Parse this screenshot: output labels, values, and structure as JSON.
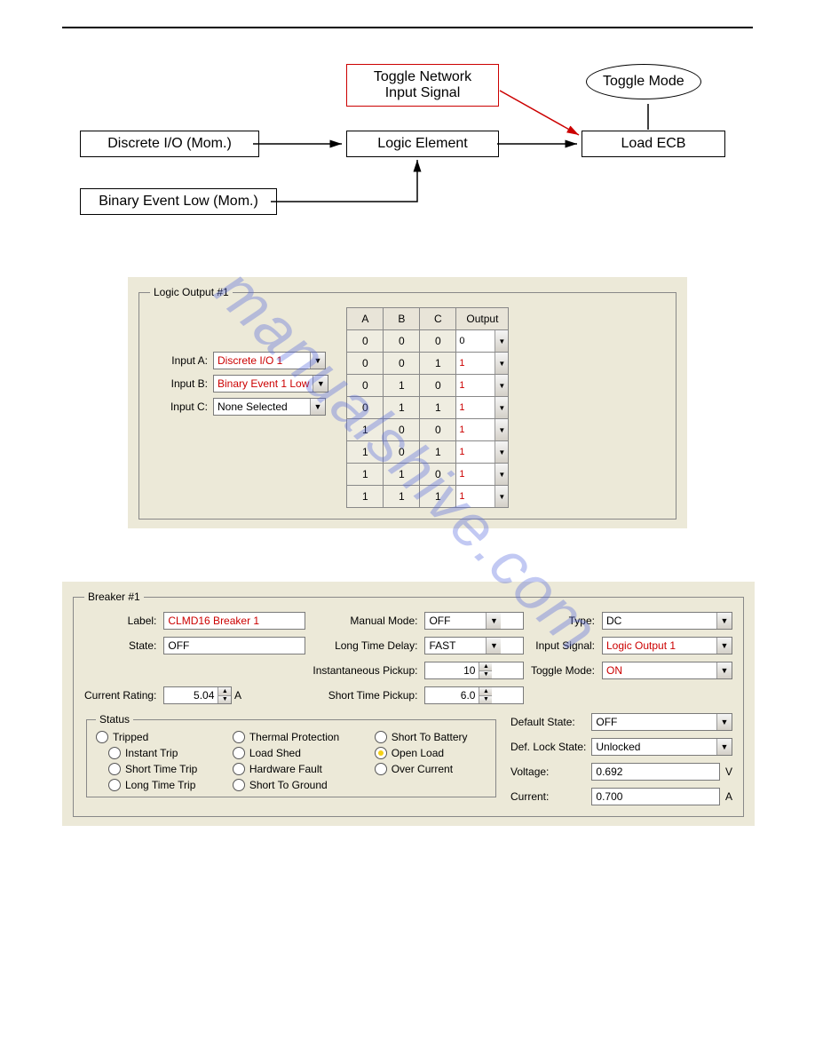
{
  "watermark": "manualshive.com",
  "diagram": {
    "discrete_io": "Discrete I/O (Mom.)",
    "binary_event": "Binary Event Low (Mom.)",
    "logic_element": "Logic Element",
    "toggle_network": "Toggle Network Input Signal",
    "load_ecb": "Load ECB",
    "toggle_mode": "Toggle Mode"
  },
  "logic": {
    "title": "Logic Output #1",
    "input_a_label": "Input A:",
    "input_b_label": "Input B:",
    "input_c_label": "Input C:",
    "input_a_value": "Discrete I/O 1",
    "input_b_value": "Binary Event 1 Low",
    "input_c_value": "None Selected",
    "headers": {
      "a": "A",
      "b": "B",
      "c": "C",
      "out": "Output"
    },
    "rows": [
      {
        "a": "0",
        "b": "0",
        "c": "0",
        "out": "0",
        "out_red": false
      },
      {
        "a": "0",
        "b": "0",
        "c": "1",
        "out": "1",
        "out_red": true
      },
      {
        "a": "0",
        "b": "1",
        "c": "0",
        "out": "1",
        "out_red": true
      },
      {
        "a": "0",
        "b": "1",
        "c": "1",
        "out": "1",
        "out_red": true
      },
      {
        "a": "1",
        "b": "0",
        "c": "0",
        "out": "1",
        "out_red": true
      },
      {
        "a": "1",
        "b": "0",
        "c": "1",
        "out": "1",
        "out_red": true
      },
      {
        "a": "1",
        "b": "1",
        "c": "0",
        "out": "1",
        "out_red": true
      },
      {
        "a": "1",
        "b": "1",
        "c": "1",
        "out": "1",
        "out_red": true
      }
    ]
  },
  "breaker": {
    "title": "Breaker #1",
    "label_lbl": "Label:",
    "label_val": "CLMD16 Breaker 1",
    "manual_mode_lbl": "Manual Mode:",
    "manual_mode_val": "OFF",
    "type_lbl": "Type:",
    "type_val": "DC",
    "state_lbl": "State:",
    "state_val": "OFF",
    "ltd_lbl": "Long Time Delay:",
    "ltd_val": "FAST",
    "input_signal_lbl": "Input Signal:",
    "input_signal_val": "Logic Output 1",
    "inst_pickup_lbl": "Instantaneous Pickup:",
    "inst_pickup_val": "10",
    "toggle_mode_lbl": "Toggle Mode:",
    "toggle_mode_val": "ON",
    "current_rating_lbl": "Current Rating:",
    "current_rating_val": "5.04",
    "current_rating_unit": "A",
    "st_pickup_lbl": "Short Time Pickup:",
    "st_pickup_val": "6.0",
    "default_state_lbl": "Default State:",
    "default_state_val": "OFF",
    "def_lock_lbl": "Def. Lock State:",
    "def_lock_val": "Unlocked",
    "voltage_lbl": "Voltage:",
    "voltage_val": "0.692",
    "voltage_unit": "V",
    "current_lbl": "Current:",
    "current_val": "0.700",
    "current_unit": "A",
    "status_title": "Status",
    "status": {
      "tripped": "Tripped",
      "instant_trip": "Instant Trip",
      "short_time_trip": "Short Time Trip",
      "long_time_trip": "Long Time Trip",
      "thermal": "Thermal Protection",
      "load_shed": "Load Shed",
      "hw_fault": "Hardware Fault",
      "short_gnd": "Short To Ground",
      "short_bat": "Short To Battery",
      "open_load": "Open Load",
      "over_current": "Over Current"
    }
  }
}
